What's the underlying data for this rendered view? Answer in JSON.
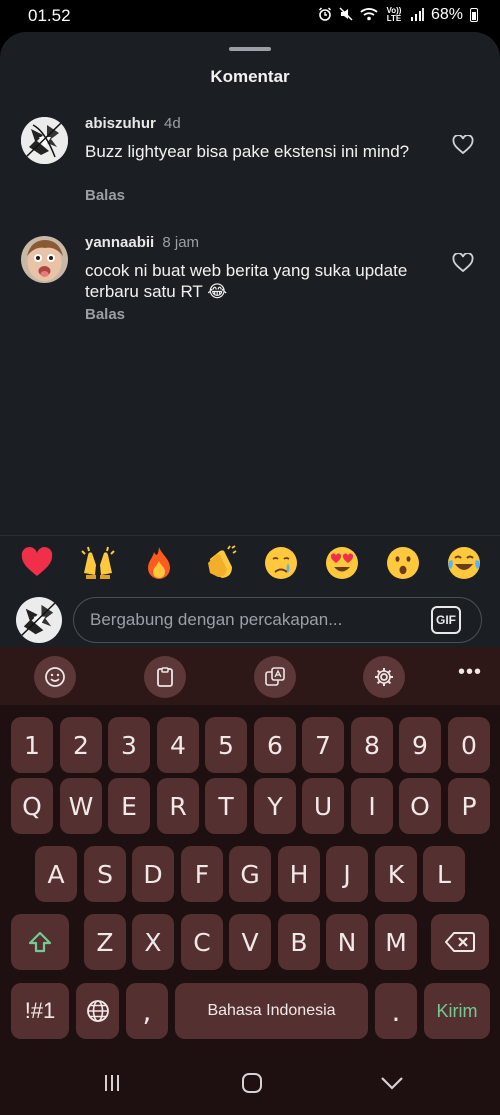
{
  "status_bar": {
    "time": "01.52",
    "volte": "Vo)) LTE",
    "battery": "68%"
  },
  "sheet": {
    "title": "Komentar"
  },
  "comments": [
    {
      "username": "abiszuhur",
      "time": "4d",
      "text": "Buzz lightyear bisa pake ekstensi ini mind?",
      "reply_label": "Balas"
    },
    {
      "username": "yannaabii",
      "time": "8 jam",
      "text": "cocok ni buat web berita  yang suka update terbaru satu RT 😂",
      "reply_label": "Balas"
    }
  ],
  "emoji_bar": [
    "red-heart",
    "raising-hands",
    "fire",
    "clapping-hands",
    "crying-face",
    "heart-eyes",
    "surprised-face",
    "tears-of-joy"
  ],
  "composer": {
    "placeholder": "Bergabung dengan percakapan...",
    "gif_label": "GIF"
  },
  "keyboard": {
    "row_numbers": [
      "1",
      "2",
      "3",
      "4",
      "5",
      "6",
      "7",
      "8",
      "9",
      "0"
    ],
    "row_top": [
      "Q",
      "W",
      "E",
      "R",
      "T",
      "Y",
      "U",
      "I",
      "O",
      "P"
    ],
    "row_middle": [
      "A",
      "S",
      "D",
      "F",
      "G",
      "H",
      "J",
      "K",
      "L"
    ],
    "row_bottom": [
      "Z",
      "X",
      "C",
      "V",
      "B",
      "N",
      "M"
    ],
    "symbols_label": "!#1",
    "comma": ",",
    "space_label": "Bahasa Indonesia",
    "period": ".",
    "send_label": "Kirim",
    "more_label": "•••"
  },
  "colors": {
    "sheet_bg": "#1b1f23",
    "keyboard_bg": "#1e1010",
    "key_bg": "#553030",
    "toolbar_bg": "#2d1717",
    "send_green": "#74c995",
    "shift_green": "#74c995"
  }
}
